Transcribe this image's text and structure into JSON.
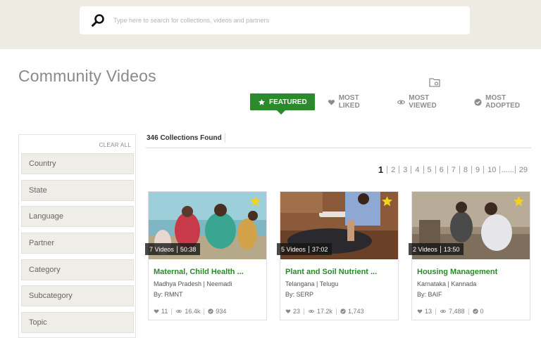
{
  "search": {
    "placeholder": "Type here to search for collections, videos and partners"
  },
  "page": {
    "title": "Community Videos"
  },
  "tabs": [
    {
      "label": "FEATURED",
      "icon": "star-icon",
      "active": true
    },
    {
      "label": "MOST LIKED",
      "icon": "heart-icon"
    },
    {
      "label": "MOST VIEWED",
      "icon": "eye-icon"
    },
    {
      "label": "MOST ADOPTED",
      "icon": "check-circle-icon"
    }
  ],
  "sidebar": {
    "clear_label": "CLEAR ALL",
    "filters": [
      "Country",
      "State",
      "Language",
      "Partner",
      "Category",
      "Subcategory",
      "Topic"
    ]
  },
  "results": {
    "found_label": "346 Collections Found"
  },
  "pagination": {
    "current": "1",
    "pages": [
      "2",
      "3",
      "4",
      "5",
      "6",
      "7",
      "8",
      "9",
      "10",
      "......",
      "29"
    ]
  },
  "cards": [
    {
      "videos": "7 Videos",
      "duration": "50:38",
      "title": "Maternal, Child Health ...",
      "meta": "Madhya Pradesh | Neemadi",
      "by": "By: RMNT",
      "likes": "11",
      "views": "16.4k",
      "adoptions": "934"
    },
    {
      "videos": "5 Videos",
      "duration": "37:02",
      "title": "Plant and Soil Nutrient ...",
      "meta": "Telangana | Telugu",
      "by": "By: SERP",
      "likes": "23",
      "views": "17.2k",
      "adoptions": "1,743"
    },
    {
      "videos": "2 Videos",
      "duration": "13:50",
      "title": "Housing Management",
      "meta": "Karnataka | Kannada",
      "by": "By: BAIF",
      "likes": "13",
      "views": "7,488",
      "adoptions": "0"
    }
  ],
  "colors": {
    "accent": "#2b8a2b",
    "top_band": "#eeebe3",
    "filter_bg": "#eeede8",
    "star": "#f2d21c"
  }
}
